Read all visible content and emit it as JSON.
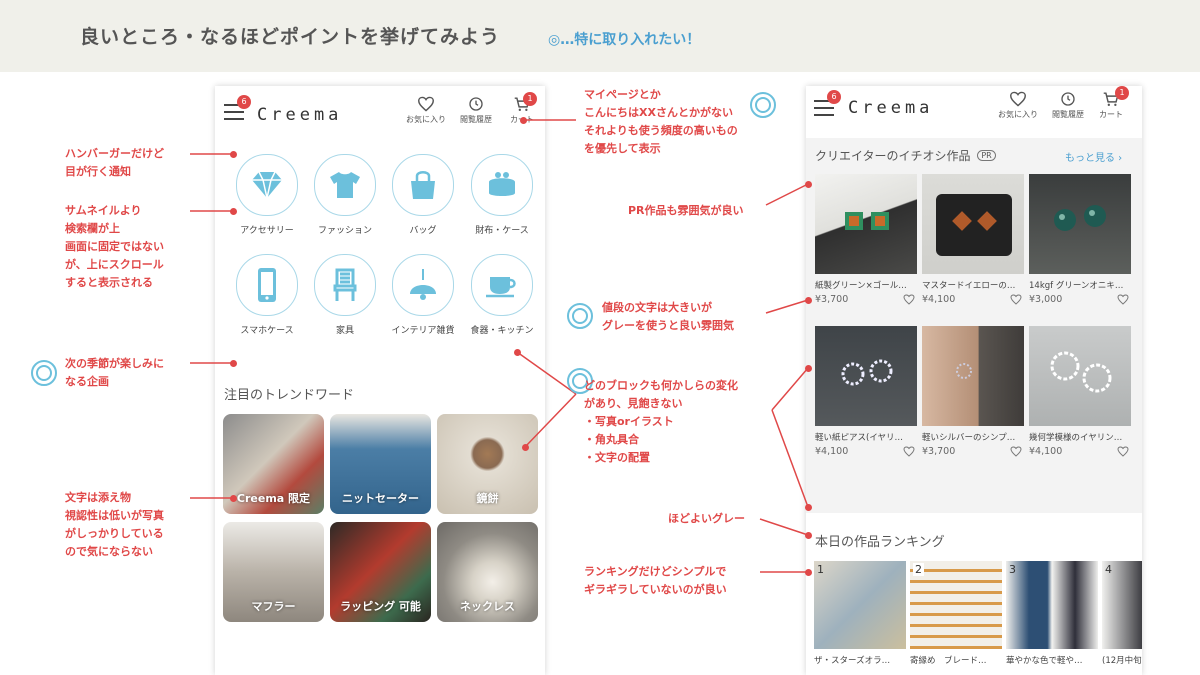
{
  "header": {
    "title": "良いところ・なるほどポイントを挙げてみよう",
    "note": "◎…特に取り入れたい！"
  },
  "phone_a": {
    "logo": "Creema",
    "notify_count": "6",
    "cart_count": "1",
    "nav": [
      "お気に入り",
      "閲覧履歴",
      "カート"
    ],
    "categories": [
      {
        "label": "アクセサリー",
        "icon": "diamond-icon"
      },
      {
        "label": "ファッション",
        "icon": "tshirt-icon"
      },
      {
        "label": "バッグ",
        "icon": "bag-icon"
      },
      {
        "label": "財布・ケース",
        "icon": "purse-icon"
      },
      {
        "label": "スマホケース",
        "icon": "smartphone-icon"
      },
      {
        "label": "家具",
        "icon": "chair-icon"
      },
      {
        "label": "インテリア雑貨",
        "icon": "lamp-icon"
      },
      {
        "label": "食器・キッチン",
        "icon": "cup-icon"
      }
    ],
    "trend_title": "注目のトレンドワード",
    "trends": [
      "Creema 限定",
      "ニットセーター",
      "鏡餅",
      "マフラー",
      "ラッピング 可能",
      "ネックレス"
    ]
  },
  "phone_b": {
    "logo": "Creema",
    "notify_count": "6",
    "cart_count": "1",
    "nav": [
      "お気に入り",
      "閲覧履歴",
      "カート"
    ],
    "pick_title": "クリエイターのイチオシ作品",
    "pr_badge": "PR",
    "more_link": "もっと見る",
    "products": [
      {
        "name": "紙製グリーン×ゴール…",
        "price": "¥3,700"
      },
      {
        "name": "マスタードイエローの…",
        "price": "¥4,100"
      },
      {
        "name": "14kgf グリーンオニキ…",
        "price": "¥3,000"
      },
      {
        "name": "軽い紙ピアス(イヤリ…",
        "price": "¥4,100"
      },
      {
        "name": "軽いシルバーのシンプ…",
        "price": "¥3,700"
      },
      {
        "name": "幾何学模様のイヤリン…",
        "price": "¥4,100"
      }
    ],
    "ranking_title": "本日の作品ランキング",
    "ranking": [
      {
        "rank": "1",
        "name": "ザ・スターズオラ…"
      },
      {
        "rank": "2",
        "name": "寄縁め　ブレード…"
      },
      {
        "rank": "3",
        "name": "華やかな色で軽や…"
      },
      {
        "rank": "4",
        "name": "(12月中旬"
      }
    ]
  },
  "annotations": {
    "hamburger": [
      "ハンバーガーだけど",
      "目が行く通知"
    ],
    "thumbnail": [
      "サムネイルより",
      "検索欄が上",
      "画面に固定ではない",
      "が、上にスクロール",
      "すると表示される"
    ],
    "season": [
      "次の季節が楽しみに",
      "なる企画"
    ],
    "text_photo": [
      "文字は添え物",
      "視認性は低いが写真",
      "がしっかりしている",
      "ので気にならない"
    ],
    "mypage": [
      "マイページとか",
      "こんにちはXXさんとかがない",
      "それよりも使う頻度の高いもの",
      "を優先して表示"
    ],
    "blocks": [
      "どのブロックも何かしらの変化",
      "があり、見飽きない",
      "・写真orイラスト",
      "・角丸具合",
      "・文字の配置"
    ],
    "pr": [
      "PR作品も雰囲気が良い"
    ],
    "price": [
      "値段の文字は大きいが",
      "グレーを使うと良い雰囲気"
    ],
    "gray": [
      "ほどよいグレー"
    ],
    "ranking": [
      "ランキングだけどシンプルで",
      "ギラギラしていないのが良い"
    ]
  },
  "colors": {
    "accent_red": "#e04848",
    "accent_blue": "#4a9fd0",
    "header_bg": "#f0f0ea",
    "icon_blue": "#6cc0dc"
  }
}
